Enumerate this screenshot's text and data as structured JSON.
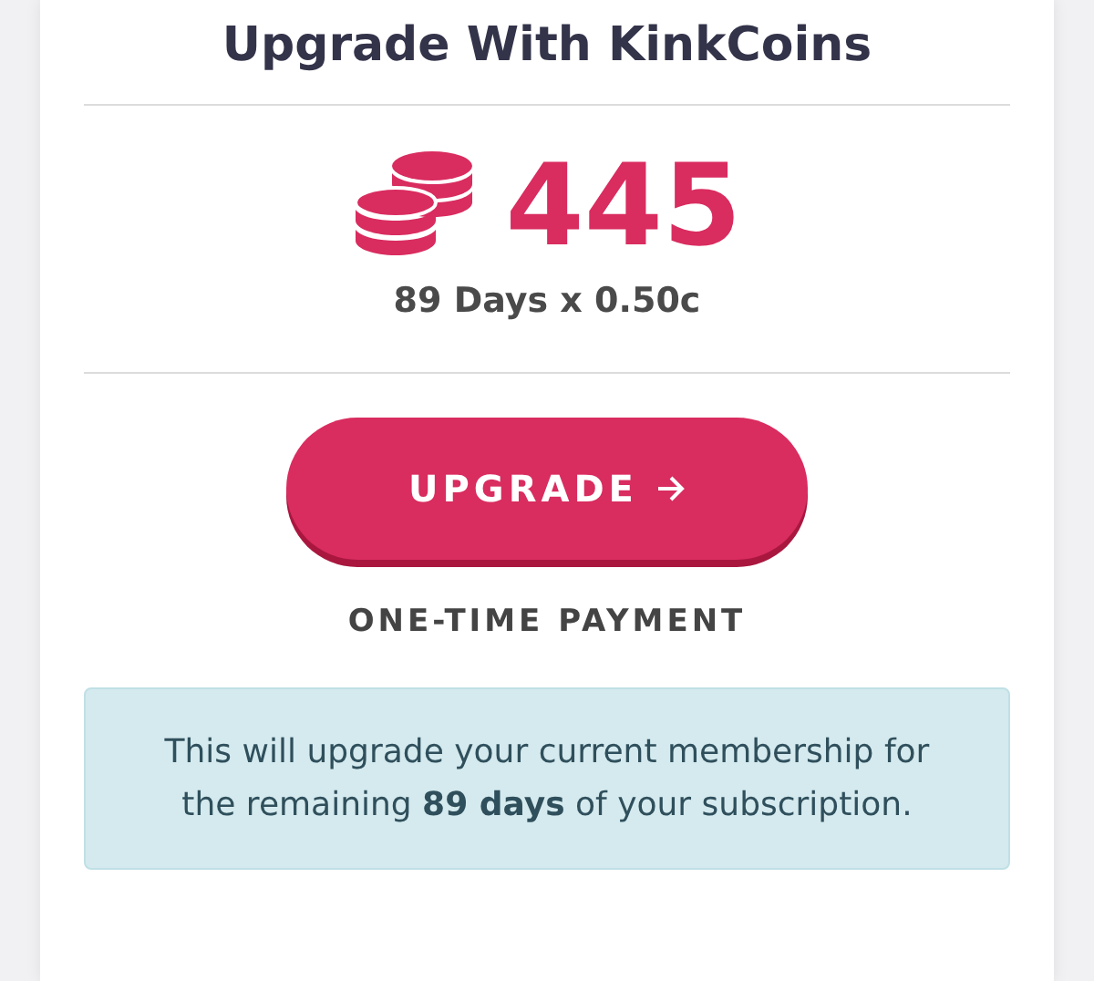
{
  "title": "Upgrade With KinkCoins",
  "price": {
    "amount": "445",
    "detail": "89 Days x 0.50c"
  },
  "button": {
    "label": "UPGRADE"
  },
  "payment_note": "ONE-TIME PAYMENT",
  "info": "This will upgrade your current membership for the remaining **89 days** of your subscription."
}
